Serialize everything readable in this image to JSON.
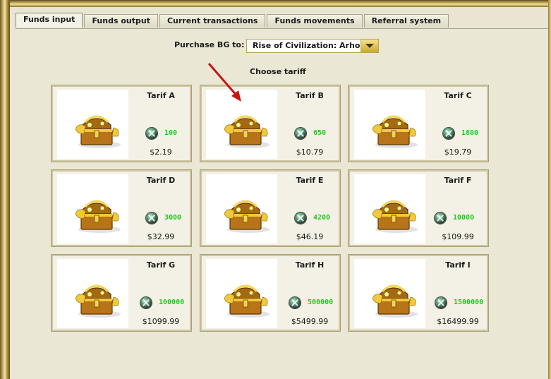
{
  "tabs": [
    {
      "label": "Funds input",
      "active": true
    },
    {
      "label": "Funds output",
      "active": false
    },
    {
      "label": "Current transactions",
      "active": false
    },
    {
      "label": "Funds movements",
      "active": false
    },
    {
      "label": "Referral system",
      "active": false
    }
  ],
  "purchase": {
    "label": "Purchase BG to:",
    "selected": "Rise of Civilization: Arhon"
  },
  "choose_label": "Choose tariff",
  "tariffs": [
    {
      "name": "Tarif A",
      "amount": "100",
      "price": "$2.19"
    },
    {
      "name": "Tarif B",
      "amount": "650",
      "price": "$10.79"
    },
    {
      "name": "Tarif C",
      "amount": "1800",
      "price": "$19.79"
    },
    {
      "name": "Tarif D",
      "amount": "3000",
      "price": "$32.99"
    },
    {
      "name": "Tarif E",
      "amount": "4200",
      "price": "$46.19"
    },
    {
      "name": "Tarif F",
      "amount": "10000",
      "price": "$109.99"
    },
    {
      "name": "Tarif G",
      "amount": "100000",
      "price": "$1099.99"
    },
    {
      "name": "Tarif H",
      "amount": "500000",
      "price": "$5499.99"
    },
    {
      "name": "Tarif I",
      "amount": "1500000",
      "price": "$16499.99"
    }
  ],
  "icons": {
    "chest": "treasure-chest-icon",
    "coin": "bg-coin-icon",
    "dropdown": "dropdown-arrow-icon",
    "pointer": "red-pointer-arrow"
  },
  "colors": {
    "amount": "#1ec81e",
    "pointer": "#c81414",
    "frame_gold": "#c9ad5c"
  }
}
